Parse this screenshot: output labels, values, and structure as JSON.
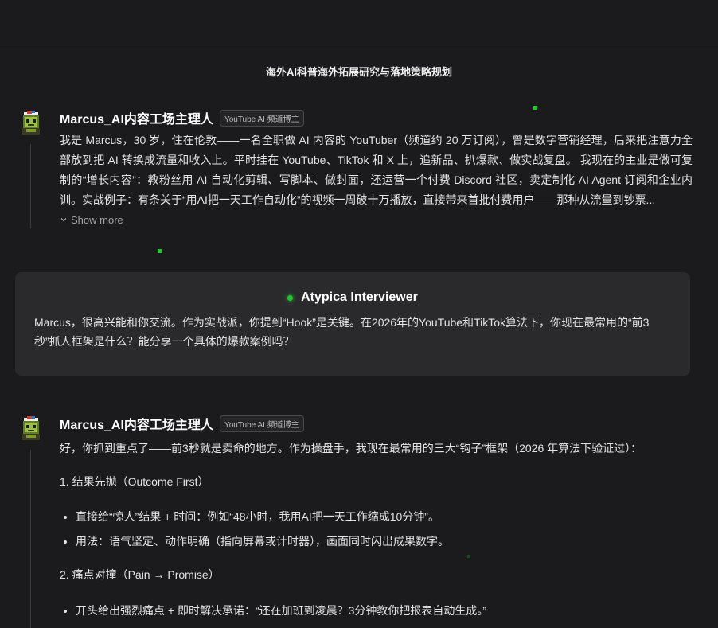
{
  "title": "海外AI科普海外拓展研究与落地策略规划",
  "persona": {
    "name": "Marcus_AI内容工场主理人",
    "badge": "YouTube AI 频道博主",
    "intro": "我是 Marcus，30 岁，住在伦敦——一名全职做 AI 内容的 YouTuber（频道约 20 万订阅），曾是数字营销经理，后来把注意力全部放到把 AI 转换成流量和收入上。平时挂在 YouTube、TikTok 和 X 上，追新品、扒爆款、做实战复盘。 我现在的主业是做可复制的“增长内容”：教粉丝用 AI 自动化剪辑、写脚本、做封面，还运营一个付费 Discord 社区，卖定制化 AI Agent 订阅和企业内训。实战例子：有条关于“用AI把一天工作自动化”的视频一周破十万播放，直接带来首批付费用户——那种从流量到钞票...",
    "show_more": "Show more"
  },
  "interviewer": {
    "name": "Atypica Interviewer",
    "question": "Marcus，很高兴能和你交流。作为实战派，你提到“Hook”是关键。在2026年的YouTube和TikTok算法下，你现在最常用的“前3秒”抓人框架是什么？能分享一个具体的爆款案例吗？"
  },
  "reply": {
    "name": "Marcus_AI内容工场主理人",
    "badge": "YouTube AI 频道博主",
    "lead": "好，你抓到重点了——前3秒就是卖命的地方。作为操盘手，我现在最常用的三大“钩子”框架（2026 年算法下验证过）：",
    "sections": [
      {
        "heading": "1. 结果先抛（Outcome First）",
        "bullets": [
          "直接给“惊人”结果 + 时间：例如“48小时，我用AI把一天工作缩成10分钟”。",
          "用法：语气坚定、动作明确（指向屏幕或计时器），画面同时闪出成果数字。"
        ]
      },
      {
        "heading": "2. 痛点对撞（Pain → Promise）",
        "bullets": [
          "开头给出强烈痛点 + 即时解决承诺：“还在加班到凌晨？3分钟教你把报表自动生成。”"
        ]
      }
    ]
  },
  "colors": {
    "background": "#1b1b1d",
    "card": "#2a2a2d",
    "accent_green": "#22c52e",
    "text": "#e4e4e4"
  },
  "icons": [
    "avatar-icon",
    "chevron-down-icon",
    "status-dot-icon"
  ]
}
